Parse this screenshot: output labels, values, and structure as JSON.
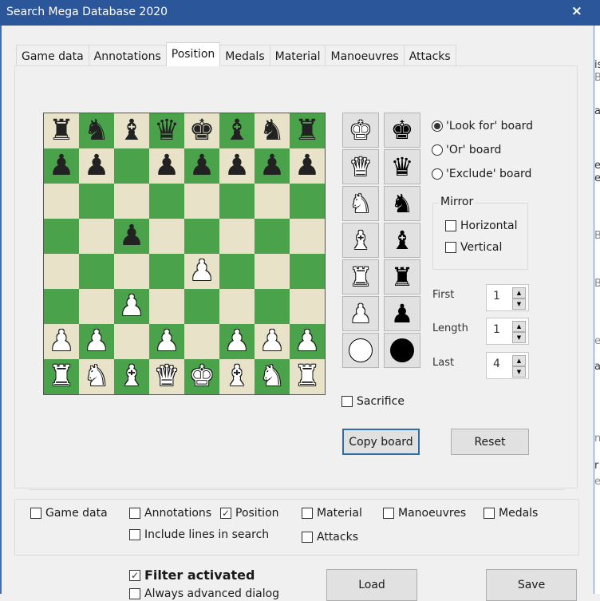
{
  "window": {
    "title": "Search Mega Database 2020",
    "close_icon": "×"
  },
  "tabs": [
    {
      "label": "Game data",
      "active": false
    },
    {
      "label": "Annotations",
      "active": false
    },
    {
      "label": "Position",
      "active": true
    },
    {
      "label": "Medals",
      "active": false
    },
    {
      "label": "Material",
      "active": false
    },
    {
      "label": "Manoeuvres",
      "active": false
    },
    {
      "label": "Attacks",
      "active": false
    }
  ],
  "board": {
    "light_color": "#e8e2c9",
    "dark_color": "#4aa24a",
    "ranks": [
      [
        "bR",
        "bN",
        "bB",
        "bQ",
        "bK",
        "bB",
        "bN",
        "bR"
      ],
      [
        "bP",
        "bP",
        "",
        "bP",
        "bP",
        "bP",
        "bP",
        "bP"
      ],
      [
        "",
        "",
        "",
        "",
        "",
        "",
        "",
        ""
      ],
      [
        "",
        "",
        "bP",
        "",
        "",
        "",
        "",
        ""
      ],
      [
        "",
        "",
        "",
        "",
        "wP",
        "",
        "",
        ""
      ],
      [
        "",
        "",
        "wP",
        "",
        "",
        "",
        "",
        ""
      ],
      [
        "wP",
        "wP",
        "",
        "wP",
        "",
        "wP",
        "wP",
        "wP"
      ],
      [
        "wR",
        "wN",
        "wB",
        "wQ",
        "wK",
        "wB",
        "wN",
        "wR"
      ]
    ],
    "glyphs": {
      "K": "♚",
      "Q": "♛",
      "R": "♜",
      "B": "♝",
      "N": "♞",
      "P": "♟"
    }
  },
  "palette": [
    {
      "name": "white-king",
      "glyph": "♚",
      "color": "w"
    },
    {
      "name": "black-king",
      "glyph": "♚",
      "color": "b"
    },
    {
      "name": "white-queen",
      "glyph": "♛",
      "color": "w"
    },
    {
      "name": "black-queen",
      "glyph": "♛",
      "color": "b"
    },
    {
      "name": "white-knight",
      "glyph": "♞",
      "color": "w"
    },
    {
      "name": "black-knight",
      "glyph": "♞",
      "color": "b"
    },
    {
      "name": "white-bishop",
      "glyph": "♝",
      "color": "w"
    },
    {
      "name": "black-bishop",
      "glyph": "♝",
      "color": "b"
    },
    {
      "name": "white-rook",
      "glyph": "♜",
      "color": "w"
    },
    {
      "name": "black-rook",
      "glyph": "♜",
      "color": "b"
    },
    {
      "name": "white-pawn",
      "glyph": "♟",
      "color": "w"
    },
    {
      "name": "black-pawn",
      "glyph": "♟",
      "color": "b"
    },
    {
      "name": "white-to-move",
      "glyph": "",
      "color": "w",
      "disc": true
    },
    {
      "name": "black-to-move",
      "glyph": "",
      "color": "b",
      "disc": true
    }
  ],
  "board_mode": {
    "look_for": {
      "label": "'Look for' board",
      "selected": true
    },
    "or": {
      "label": "'Or' board",
      "selected": false
    },
    "exclude": {
      "label": "'Exclude' board",
      "selected": false
    }
  },
  "mirror": {
    "title": "Mirror",
    "horizontal": {
      "label": "Horizontal",
      "checked": false
    },
    "vertical": {
      "label": "Vertical",
      "checked": false
    }
  },
  "range": {
    "first": {
      "label": "First",
      "value": "1"
    },
    "length": {
      "label": "Length",
      "value": "1"
    },
    "last": {
      "label": "Last",
      "value": "4"
    }
  },
  "sacrifice": {
    "label": "Sacrifice",
    "checked": false
  },
  "buttons": {
    "copy_board": "Copy board",
    "reset": "Reset",
    "load": "Load",
    "save": "Save"
  },
  "criteria": {
    "game_data": {
      "label": "Game data",
      "checked": false
    },
    "annotations": {
      "label": "Annotations",
      "checked": false
    },
    "position": {
      "label": "Position",
      "checked": true
    },
    "material": {
      "label": "Material",
      "checked": false
    },
    "manoeuvres": {
      "label": "Manoeuvres",
      "checked": false
    },
    "medals": {
      "label": "Medals",
      "checked": false
    },
    "include_lines": {
      "label": "Include lines in search",
      "checked": false
    },
    "attacks": {
      "label": "Attacks",
      "checked": false
    }
  },
  "filter": {
    "activated": {
      "label": "Filter activated",
      "checked": true
    },
    "always_advanced": {
      "label": "Always advanced dialog",
      "checked": false
    }
  },
  "check_glyph": "✓"
}
